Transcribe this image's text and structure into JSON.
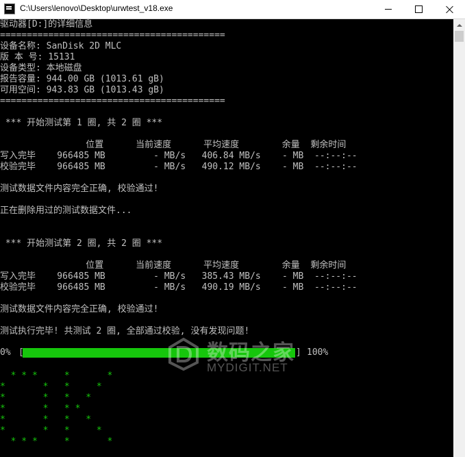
{
  "window": {
    "title": "C:\\Users\\lenovo\\Desktop\\urwtest_v18.exe",
    "minimize_label": "—",
    "maximize_label": "☐",
    "close_label": "✕"
  },
  "console": {
    "lines": [
      "驱动器[D:]的详细信息",
      "==========================================",
      "设备名称: SanDisk 2D MLC",
      "版 本 号: 15131",
      "设备类型: 本地磁盘",
      "报告容量: 944.00 GB (1013.61 gB)",
      "可用空间: 943.83 GB (1013.43 gB)",
      "==========================================",
      "",
      " *** 开始测试第 1 圈, 共 2 圈 ***",
      "",
      "                位置      当前速度      平均速度        余量  剩余时间",
      "写入完毕    966485 MB         - MB/s   406.84 MB/s    - MB  --:--:--",
      "校验完毕    966485 MB         - MB/s   490.12 MB/s    - MB  --:--:--",
      "",
      "测试数据文件内容完全正确, 校验通过!",
      "",
      "正在删除用过的测试数据文件...",
      "",
      "",
      " *** 开始测试第 2 圈, 共 2 圈 ***",
      "",
      "                位置      当前速度      平均速度        余量  剩余时间",
      "写入完毕    966485 MB         - MB/s   385.43 MB/s    - MB  --:--:--",
      "校验完毕    966485 MB         - MB/s   490.19 MB/s    - MB  --:--:--",
      "",
      "测试数据文件内容完全正确, 校验通过!",
      "",
      "测试执行完毕! 共测试 2 圈, 全部通过校验, 没有发现问题!"
    ]
  },
  "progress": {
    "start_label": "0%",
    "bracket_left": "[",
    "bracket_right": "]",
    "end_label": "100%",
    "fraction": 1.0,
    "color": "#16c60c"
  },
  "ok_art": {
    "rows": [
      "  * * *     *       *",
      "*       *   *     *",
      "*       *   *   *",
      "*       *   * *",
      "*       *   *   *",
      "*       *   *     *",
      "  * * *     *       *"
    ],
    "color": "#16c60c"
  },
  "watermark": {
    "cn_text": "数码之家",
    "en_text": "MYDIGIT.NET"
  },
  "icons": {
    "app": "console-app-icon",
    "scroll_up": "scroll-up-arrow-icon"
  }
}
